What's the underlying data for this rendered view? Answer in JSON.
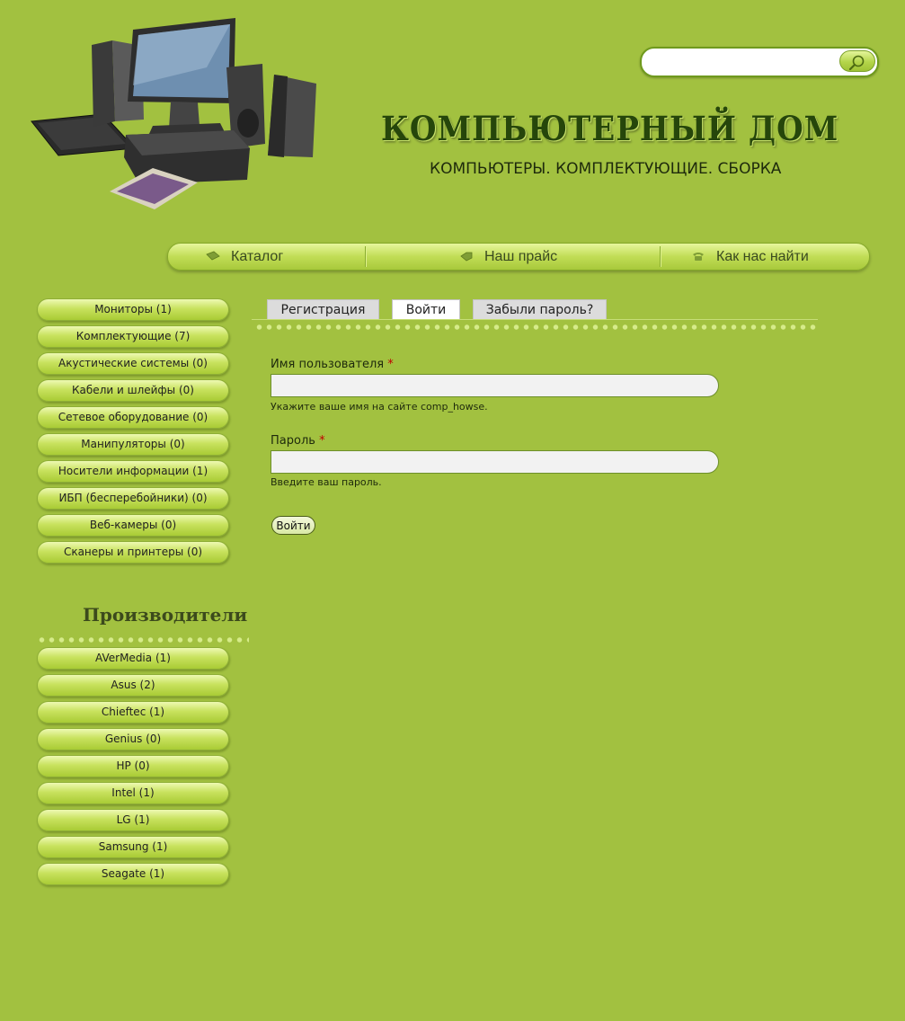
{
  "header": {
    "title": "Компьютерный дом",
    "slogan": "Компьютеры. Комплектующие. Сборка"
  },
  "search": {
    "value": "",
    "placeholder": "",
    "button_icon": "magnifier-icon"
  },
  "nav": {
    "items": [
      {
        "label": "Каталог",
        "icon": "catalog-icon"
      },
      {
        "label": "Наш прайс",
        "icon": "price-tag-icon"
      },
      {
        "label": "Как нас найти",
        "icon": "phone-icon"
      }
    ]
  },
  "categories": [
    {
      "label": "Мониторы (1)"
    },
    {
      "label": "Комплектующие (7)"
    },
    {
      "label": "Акустические системы (0)"
    },
    {
      "label": "Кабели и шлейфы (0)"
    },
    {
      "label": "Сетевое оборудование (0)"
    },
    {
      "label": "Манипуляторы (0)"
    },
    {
      "label": "Носители информации (1)"
    },
    {
      "label": "ИБП (бесперебойники) (0)"
    },
    {
      "label": "Веб-камеры (0)"
    },
    {
      "label": "Сканеры и принтеры (0)"
    }
  ],
  "makers": {
    "title": "Производители",
    "items": [
      {
        "label": "AVerMedia (1)"
      },
      {
        "label": "Asus (2)"
      },
      {
        "label": "Chieftec (1)"
      },
      {
        "label": "Genius (0)"
      },
      {
        "label": "HP (0)"
      },
      {
        "label": "Intel (1)"
      },
      {
        "label": "LG (1)"
      },
      {
        "label": "Samsung (1)"
      },
      {
        "label": "Seagate (1)"
      }
    ]
  },
  "tabs": [
    {
      "label": "Регистрация",
      "active": false
    },
    {
      "label": "Войти",
      "active": true
    },
    {
      "label": "Забыли пароль?",
      "active": false
    }
  ],
  "form": {
    "username_label": "Имя пользователя",
    "username_value": "",
    "username_desc": "Укажите ваше имя на сайте comp_howse.",
    "password_label": "Пароль",
    "password_value": "",
    "password_desc": "Введите ваш пароль.",
    "required_mark": "*",
    "submit_label": "Войти"
  },
  "colors": {
    "page_bg": "#a2c140",
    "button_light": "#eef9b2",
    "button_dark": "#a9cb35",
    "title_color": "#26460b"
  }
}
